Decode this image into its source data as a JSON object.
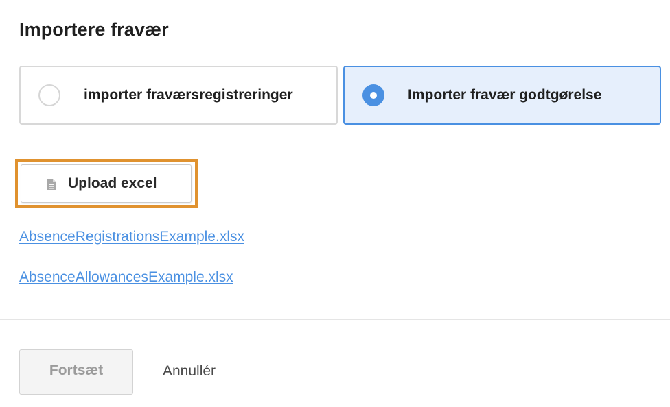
{
  "dialog": {
    "title": "Importere fravær"
  },
  "options": [
    {
      "label": "importer fraværsregistreringer",
      "selected": false
    },
    {
      "label": "Importer fravær godtgørelse",
      "selected": true
    }
  ],
  "upload": {
    "label": "Upload excel",
    "icon": "document-icon",
    "highlight_color": "#e0922f"
  },
  "example_files": [
    {
      "label": "AbsenceRegistrationsExample.xlsx"
    },
    {
      "label": "AbsenceAllowancesExample.xlsx"
    }
  ],
  "footer": {
    "continue_label": "Fortsæt",
    "continue_enabled": false,
    "cancel_label": "Annullér"
  },
  "colors": {
    "accent": "#4a90e2",
    "selected_background": "#e6effc",
    "link": "#4a90e2"
  }
}
